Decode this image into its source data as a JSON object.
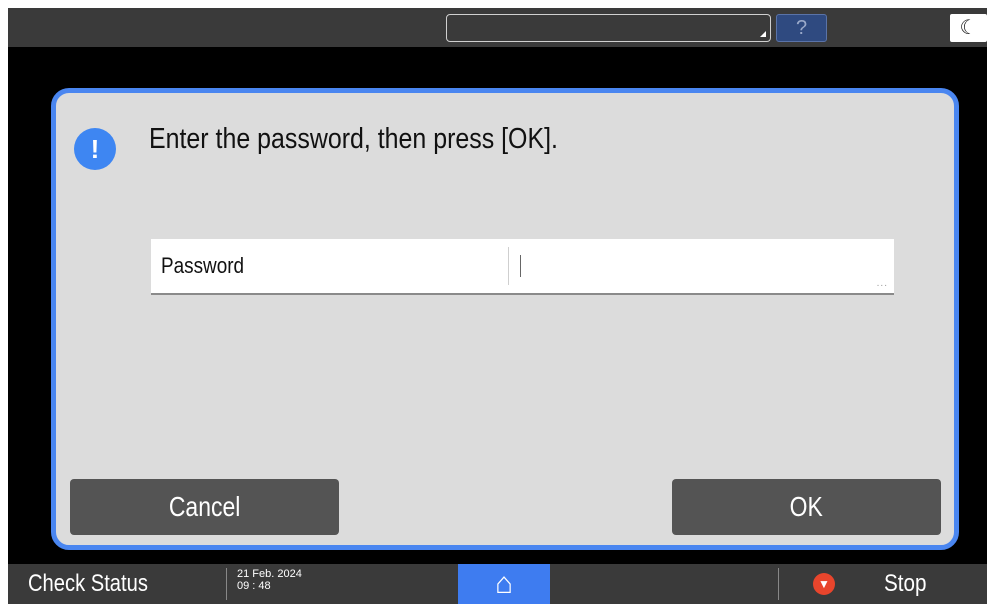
{
  "topbar": {
    "help_icon": "?",
    "sleep_icon": "☾"
  },
  "dialog": {
    "info_icon": "!",
    "message": "Enter the password, then press [OK].",
    "password": {
      "label": "Password",
      "value": "",
      "more_indicator": "..."
    },
    "cancel_label": "Cancel",
    "ok_label": "OK"
  },
  "bottombar": {
    "check_status_label": "Check Status",
    "date": "21 Feb. 2024",
    "time": "09 : 48",
    "home_icon": "⌂",
    "stop_label": "Stop"
  },
  "colors": {
    "accent": "#4a86f0",
    "home_button": "#3e7cf0",
    "stop_icon": "#e8452c",
    "button": "#545454"
  }
}
